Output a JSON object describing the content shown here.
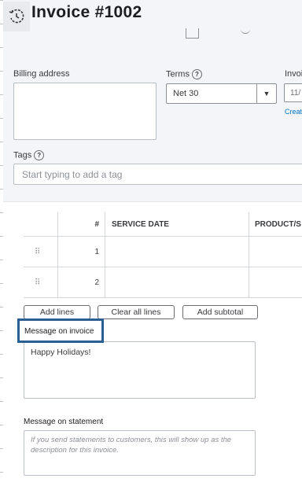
{
  "header": {
    "title": "Invoice #1002",
    "history_icon": "history-clock-icon"
  },
  "billing": {
    "label": "Billing address",
    "value": ""
  },
  "terms": {
    "label": "Terms",
    "help": "?",
    "value": "Net 30",
    "arrow": "▼"
  },
  "invoice_date": {
    "label": "Invoi",
    "value": "11/",
    "create_link": "Creat"
  },
  "tags": {
    "label": "Tags",
    "help": "?",
    "placeholder": "Start typing to add a tag"
  },
  "table": {
    "headers": [
      "#",
      "SERVICE DATE",
      "PRODUCT/S"
    ],
    "rows": [
      {
        "num": "1",
        "service_date": "",
        "product": ""
      },
      {
        "num": "2",
        "service_date": "",
        "product": ""
      }
    ],
    "drag_glyph": "⠿"
  },
  "actions": {
    "add_lines": "Add lines",
    "clear_all_lines": "Clear all lines",
    "add_subtotal": "Add subtotal"
  },
  "message_invoice": {
    "label": "Message on invoice",
    "value": "Happy Holidays!"
  },
  "message_statement": {
    "label": "Message on statement",
    "placeholder": "If you send statements to customers, this will show up as the description for this invoice."
  },
  "colors": {
    "link": "#0077c5",
    "highlight_border": "#2c5f91",
    "panel_bg": "#f4f5f8"
  }
}
